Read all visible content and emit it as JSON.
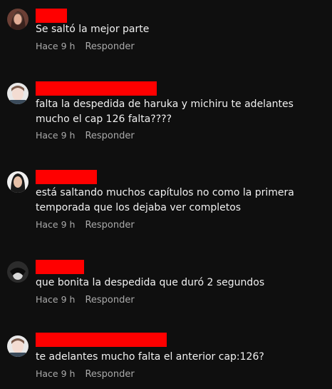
{
  "colors": {
    "background": "#0f0f0f",
    "text": "#f1f1f1",
    "meta_text": "#aaaaaa",
    "redaction": "#ff0000"
  },
  "comments": [
    {
      "avatar": "user-avatar-woman-dark-hair",
      "text": "Se saltó la mejor parte",
      "time": "Hace 9 h",
      "reply_label": "Responder"
    },
    {
      "avatar": "user-avatar-pale-face",
      "text": "falta la despedida de haruka y michiru te adelantes mucho el cap 126 falta????",
      "time": "Hace 9 h",
      "reply_label": "Responder"
    },
    {
      "avatar": "user-avatar-woman-portrait",
      "text": "está saltando muchos capítulos no como la primera temporada que los dejaba ver completos",
      "time": "Hace 9 h",
      "reply_label": "Responder"
    },
    {
      "avatar": "user-avatar-anime-character",
      "text": "que bonita la despedida que duró 2 segundos",
      "time": "Hace 9 h",
      "reply_label": "Responder"
    },
    {
      "avatar": "user-avatar-pale-face",
      "text": "te adelantes mucho falta el anterior cap:126?",
      "time": "Hace 9 h",
      "reply_label": "Responder"
    }
  ]
}
